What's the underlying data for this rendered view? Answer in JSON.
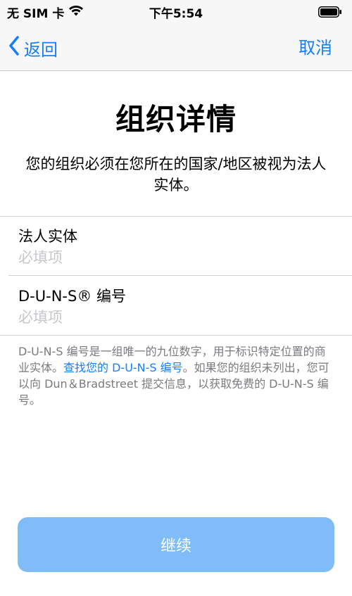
{
  "status_bar": {
    "carrier": "无 SIM 卡",
    "time": "下午5:54"
  },
  "nav": {
    "back_label": "返回",
    "cancel_label": "取消"
  },
  "page": {
    "title": "组织详情",
    "subtitle": "您的组织必须在您所在的国家/地区被视为法人实体。"
  },
  "form": {
    "fields": [
      {
        "label": "法人实体",
        "placeholder": "必填项",
        "value": ""
      },
      {
        "label": "D-U-N-S® 编号",
        "placeholder": "必填项",
        "value": ""
      }
    ]
  },
  "footnote": {
    "before_link": "D-U-N-S 编号是一组唯一的九位数字，用于标识特定位置的商业实体。",
    "link_text": "查找您的 D-U-N-S 编号",
    "after_link": "。如果您的组织未列出，您可以向 Dun＆Bradstreet 提交信息，以获取免费的 D-U-N-S 编号。"
  },
  "actions": {
    "continue_label": "继续"
  }
}
